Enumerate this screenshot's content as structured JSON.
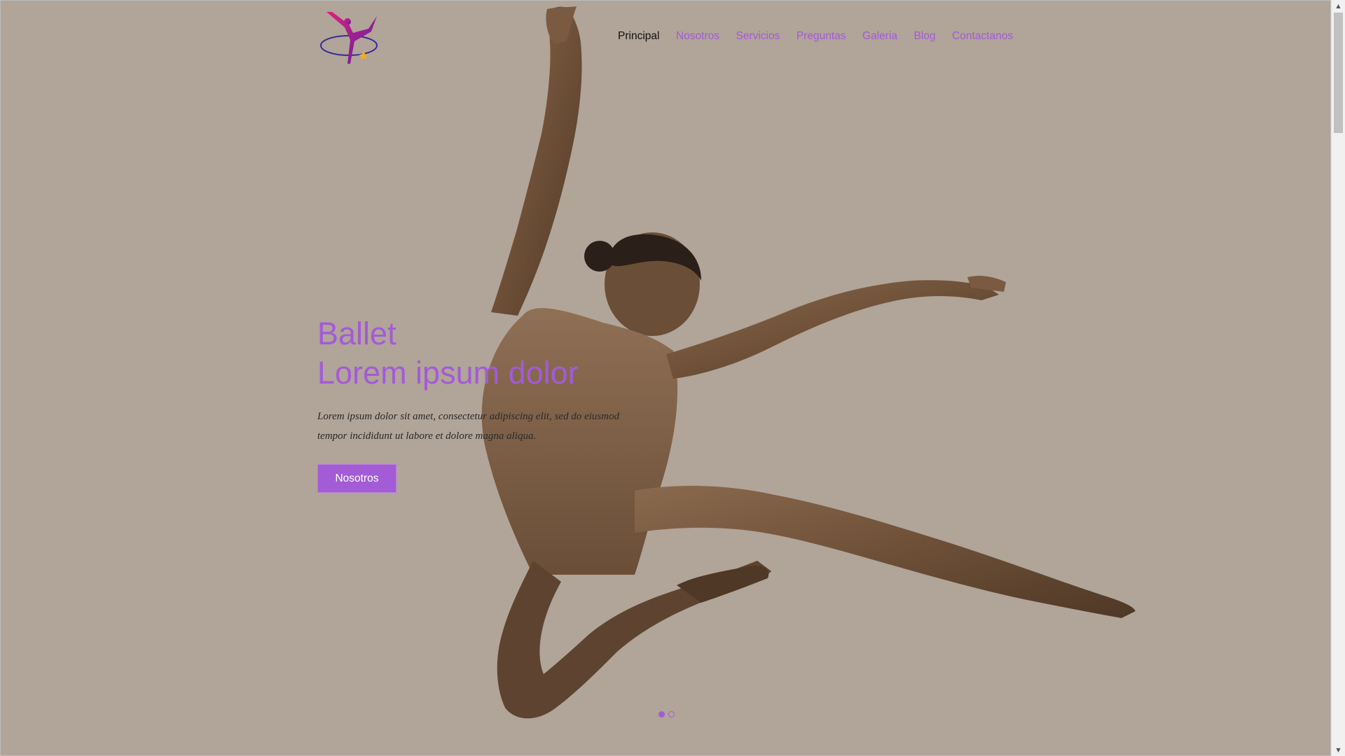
{
  "header": {
    "logo_icon": "dancer-logo-icon",
    "nav": [
      {
        "label": "Principal",
        "active": true
      },
      {
        "label": "Nosotros",
        "active": false
      },
      {
        "label": "Servicios",
        "active": false
      },
      {
        "label": "Preguntas",
        "active": false
      },
      {
        "label": "Galeria",
        "active": false
      },
      {
        "label": "Blog",
        "active": false
      },
      {
        "label": "Contactanos",
        "active": false
      }
    ]
  },
  "hero": {
    "title_line1": "Ballet",
    "title_line2": "Lorem ipsum dolor",
    "text": "Lorem ipsum dolor sit amet, consectetur adipiscing elit, sed do eiusmod tempor incididunt ut labore et dolore magna aliqua.",
    "button_label": "Nosotros",
    "slides": 2,
    "active_slide": 1
  },
  "colors": {
    "accent": "#a35bd6",
    "background": "#b1a498",
    "nav_active": "#111111"
  }
}
